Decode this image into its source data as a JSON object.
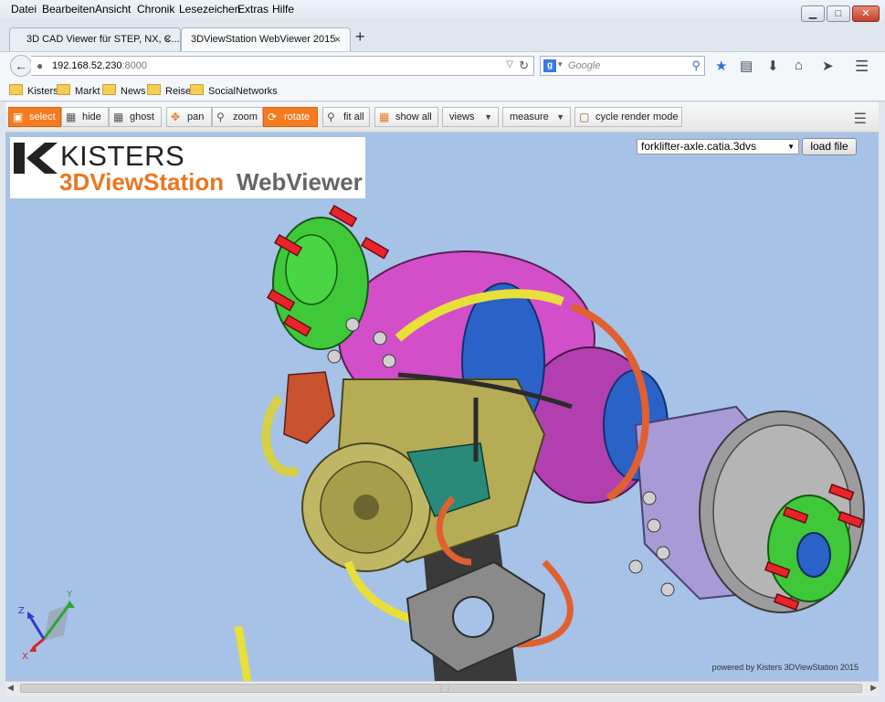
{
  "menu": [
    "Datei",
    "Bearbeiten",
    "Ansicht",
    "Chronik",
    "Lesezeichen",
    "Extras",
    "Hilfe"
  ],
  "window_controls": {
    "minimize": "▁",
    "maximize": "□",
    "close": "✕"
  },
  "tabs": [
    {
      "title": "3D CAD Viewer für STEP, NX, C...",
      "close": "×"
    },
    {
      "title": "3DViewStation WebViewer 2015",
      "close": "×"
    }
  ],
  "new_tab_symbol": "+",
  "url": {
    "host": "192.168.52.230",
    "port": ":8000"
  },
  "search": {
    "placeholder": "Google",
    "engine_letter": "g"
  },
  "bookmarks": [
    "Kisters",
    "Markt",
    "News",
    "Reise",
    "SocialNetworks"
  ],
  "toolbar": {
    "select": "select",
    "hide": "hide",
    "ghost": "ghost",
    "pan": "pan",
    "zoom": "zoom",
    "rotate": "rotate",
    "fit_all": "fit all",
    "show_all": "show all",
    "views": "views",
    "measure": "measure",
    "cycle_render_mode": "cycle render mode"
  },
  "logo": {
    "line1": "KISTERS",
    "line2a": "3DViewStation",
    "line2b": "WebViewer"
  },
  "file_select": {
    "value": "forklifter-axle.catia.3dvs"
  },
  "load_file_label": "load file",
  "powered_by": "powered by Kisters 3DViewStation 2015",
  "axes": {
    "x": "X",
    "y": "Y",
    "z": "Z"
  },
  "colors": {
    "accent": "#f47b20",
    "viewport_bg": "#a6c2e6",
    "brand_orange": "#e87722"
  }
}
